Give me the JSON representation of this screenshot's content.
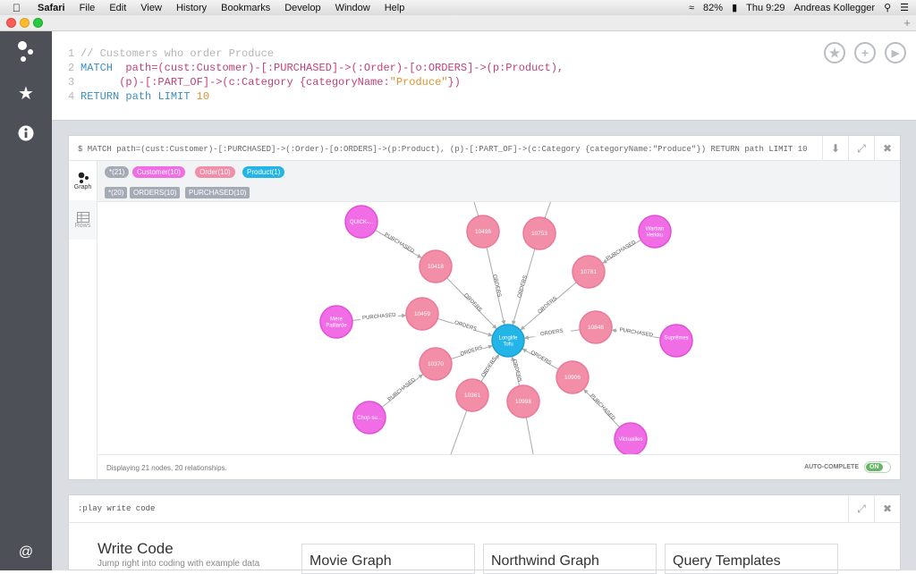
{
  "menubar": {
    "app": "Safari",
    "items": [
      "File",
      "Edit",
      "View",
      "History",
      "Bookmarks",
      "Develop",
      "Window",
      "Help"
    ],
    "battery": "82%",
    "clock": "Thu 9:29",
    "user": "Andreas Kollegger"
  },
  "editor": {
    "lines": [
      {
        "n": "1",
        "parts": [
          {
            "t": "// Customers who order Produce",
            "c": "cm"
          }
        ]
      },
      {
        "n": "2",
        "parts": [
          {
            "t": "MATCH ",
            "c": "kw"
          },
          {
            "t": " path=(cust:Customer)-[:PURCHASED]->(:Order)-[o:ORDERS]->(p:Product),",
            "c": "tx"
          }
        ]
      },
      {
        "n": "3",
        "parts": [
          {
            "t": "      (p)-[:PART_OF]->(c:Category {categoryName:",
            "c": "tx"
          },
          {
            "t": "\"Produce\"",
            "c": "st"
          },
          {
            "t": "})",
            "c": "tx"
          }
        ]
      },
      {
        "n": "4",
        "parts": [
          {
            "t": "RETURN ",
            "c": "kw"
          },
          {
            "t": "path ",
            "c": "kw"
          },
          {
            "t": "LIMIT ",
            "c": "kw"
          },
          {
            "t": "10",
            "c": "st"
          }
        ]
      }
    ]
  },
  "frame": {
    "query": "$ MATCH path=(cust:Customer)-[:PURCHASED]->(:Order)-[o:ORDERS]->(p:Product), (p)-[:PART_OF]->(c:Category {categoryName:\"Produce\"}) RETURN path LIMIT 10",
    "tabs": {
      "graph": "Graph",
      "rows": "Rows"
    },
    "node_tags": [
      {
        "label": "*(21)",
        "color": "#a5abb6"
      },
      {
        "label": "Customer(10)",
        "color": "#f16de6"
      },
      {
        "label": "Order(10)",
        "color": "#f28ea8"
      },
      {
        "label": "Product(1)",
        "color": "#23b4e8"
      }
    ],
    "rel_tags": [
      "*(20)",
      "ORDERS(10)",
      "PURCHASED(10)"
    ],
    "footer": "Displaying 21 nodes, 20 relationships.",
    "autocomplete": "AUTO-COMPLETE",
    "toggle": "ON"
  },
  "graph": {
    "center": {
      "label": "Longlife\nTofu"
    },
    "orders": [
      "10496",
      "10753",
      "10418",
      "10781",
      "10459",
      "10846",
      "10370",
      "10906",
      "10361",
      "10998"
    ],
    "customers": [
      "QUICK-...",
      "Wartian\nHerkku",
      "Mère\nPaillarde",
      "Suprêmes\n",
      "Chop-su...",
      "Victuailles"
    ],
    "rel_labels": {
      "purchased": "PURCHASED",
      "orders": "ORDERS"
    }
  },
  "frame2": {
    "command": ":play write code",
    "title": "Write Code",
    "subtitle": "Jump right into coding with example data",
    "cards": [
      "Movie Graph",
      "Northwind Graph",
      "Query Templates"
    ]
  }
}
